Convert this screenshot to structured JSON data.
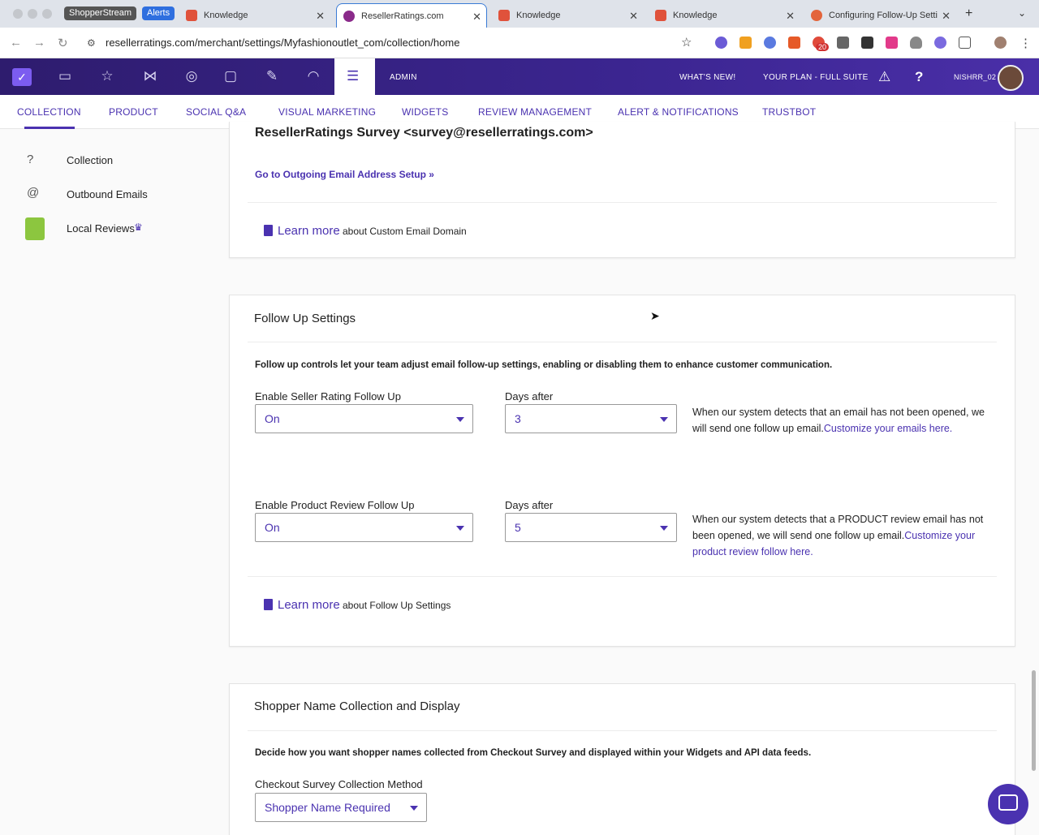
{
  "browser": {
    "tabs": [
      {
        "label": "ShopperStream"
      },
      {
        "label": "Alerts"
      },
      {
        "label": "Knowledge"
      },
      {
        "label": "ResellerRatings.com"
      },
      {
        "label": "Knowledge"
      },
      {
        "label": "Knowledge"
      },
      {
        "label": "Configuring Follow-Up Setti"
      }
    ],
    "url": "resellerratings.com/merchant/settings/Myfashionoutlet_com/collection/home",
    "extension_badge": "20"
  },
  "header": {
    "admin_label": "ADMIN",
    "whats_new": "WHAT'S NEW!",
    "plan": "YOUR PLAN - FULL SUITE",
    "help": "?",
    "user": "NISHRR_02"
  },
  "subnav": {
    "items": [
      "COLLECTION",
      "PRODUCT",
      "SOCIAL Q&A",
      "VISUAL MARKETING",
      "WIDGETS",
      "REVIEW MANAGEMENT",
      "ALERT & NOTIFICATIONS",
      "TRUSTBOT"
    ]
  },
  "sidebar": {
    "items": [
      {
        "label": "Collection",
        "icon": "question-circle-icon"
      },
      {
        "label": "Outbound Emails",
        "icon": "at-icon"
      },
      {
        "label": "Local Reviews",
        "icon": "shopping-bag-icon"
      }
    ]
  },
  "email_card": {
    "sender": "ResellerRatings Survey <survey@resellerratings.com>",
    "setup_link": "Go to Outgoing Email Address Setup »",
    "learn_more": "Learn more",
    "learn_more_suffix": "about Custom Email Domain"
  },
  "follow_up": {
    "title": "Follow Up Settings",
    "description": "Follow up controls let your team adjust email follow-up settings, enabling or disabling them to enhance customer communication.",
    "seller": {
      "label": "Enable Seller Rating Follow Up",
      "value": "On",
      "days_label": "Days after",
      "days_value": "3",
      "help_text": "When our system detects that an email has not been opened, we will send one follow up email.",
      "help_link": "Customize your emails here."
    },
    "product": {
      "label": "Enable Product Review Follow Up",
      "value": "On",
      "days_label": "Days after",
      "days_value": "5",
      "help_text": "When our system detects that a PRODUCT review email has not been opened, we will send one follow up email.",
      "help_link": "Customize your product review follow here."
    },
    "learn_more": "Learn more",
    "learn_more_suffix": "about Follow Up Settings"
  },
  "shopper_name": {
    "title": "Shopper Name Collection and Display",
    "description": "Decide how you want shopper names collected from Checkout Survey and displayed within your Widgets and API data feeds.",
    "method_label": "Checkout Survey Collection Method",
    "method_value": "Shopper Name Required"
  },
  "colors": {
    "brand": "#4a32b0",
    "header_dark": "#2e1c6e"
  }
}
